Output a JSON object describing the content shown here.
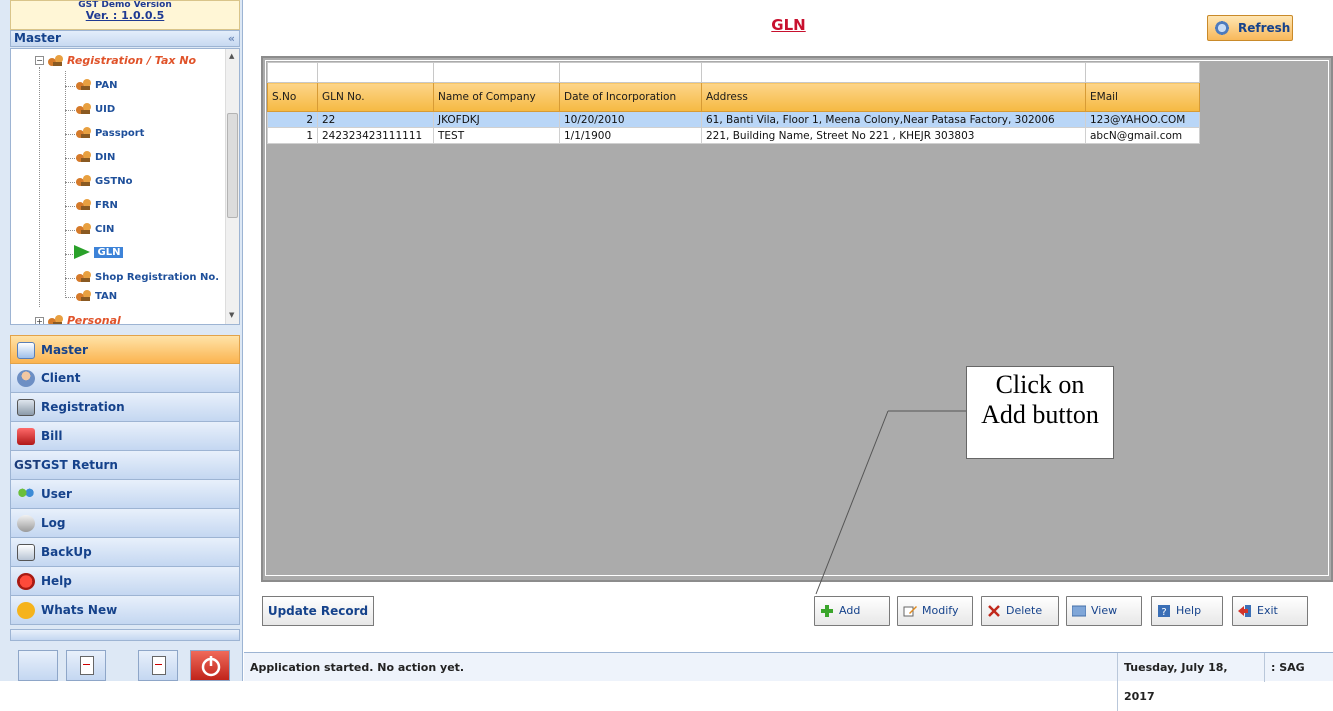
{
  "app": {
    "version_top": "GST Demo Version",
    "version": "Ver. : 1.0.0.5"
  },
  "sidebar": {
    "master_header": "Master",
    "collapse_glyph": "«",
    "tree": {
      "root_label": "Registration / Tax No",
      "items": [
        "PAN",
        "UID",
        "Passport",
        "DIN",
        "GSTNo",
        "FRN",
        "CIN",
        "GLN",
        "Shop Registration No.",
        "TAN"
      ],
      "selected": "GLN",
      "next_root_label": "Personal"
    },
    "nav": [
      {
        "label": "Master",
        "icon": "master-icon"
      },
      {
        "label": "Client",
        "icon": "client-icon"
      },
      {
        "label": "Registration",
        "icon": "registration-icon"
      },
      {
        "label": "Bill",
        "icon": "bill-icon"
      },
      {
        "label": "GST Return",
        "icon": "gst-icon",
        "prefix": "GST"
      },
      {
        "label": "User",
        "icon": "user-icon"
      },
      {
        "label": "Log",
        "icon": "log-icon"
      },
      {
        "label": "BackUp",
        "icon": "backup-icon"
      },
      {
        "label": "Help",
        "icon": "help-icon"
      },
      {
        "label": "Whats New",
        "icon": "new-icon"
      }
    ]
  },
  "page": {
    "title": "GLN",
    "refresh_label": "Refresh"
  },
  "grid": {
    "columns": [
      "S.No",
      "GLN No.",
      "Name of Company",
      "Date of Incorporation",
      "Address",
      "EMail"
    ],
    "rows": [
      [
        "2",
        "22",
        "JKOFDKJ",
        "10/20/2010",
        "61, Banti Vila, Floor 1, Meena Colony,Near Patasa Factory, 302006",
        "123@YAHOO.COM"
      ],
      [
        "1",
        "242323423111111",
        "TEST",
        "1/1/1900",
        "221, Building Name, Street No 221 , KHEJR 303803",
        "abcN@gmail.com"
      ]
    ]
  },
  "callout": {
    "line1": "Click on",
    "line2": "Add button"
  },
  "actions": {
    "update": "Update Record",
    "add": "Add",
    "modify": "Modify",
    "delete": "Delete",
    "view": "View",
    "help": "Help",
    "exit": "Exit"
  },
  "status": {
    "message": "Application started. No action yet.",
    "date": "Tuesday, July 18, 2017",
    "user": ": SAG"
  }
}
